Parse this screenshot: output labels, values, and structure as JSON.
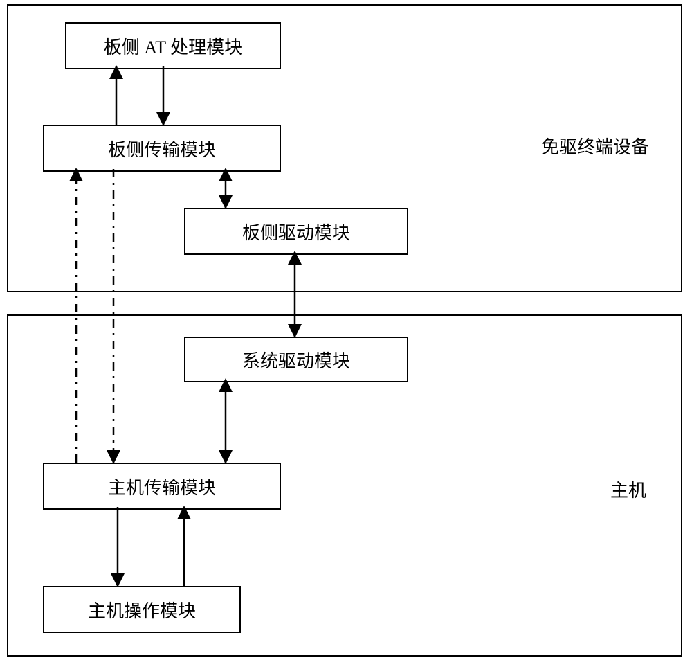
{
  "containers": {
    "top": {
      "label": "免驱终端设备"
    },
    "bottom": {
      "label": "主机"
    }
  },
  "modules": {
    "board_at": "板侧 AT 处理模块",
    "board_tx": "板侧传输模块",
    "board_drv": "板侧驱动模块",
    "sys_drv": "系统驱动模块",
    "host_tx": "主机传输模块",
    "host_op": "主机操作模块"
  }
}
